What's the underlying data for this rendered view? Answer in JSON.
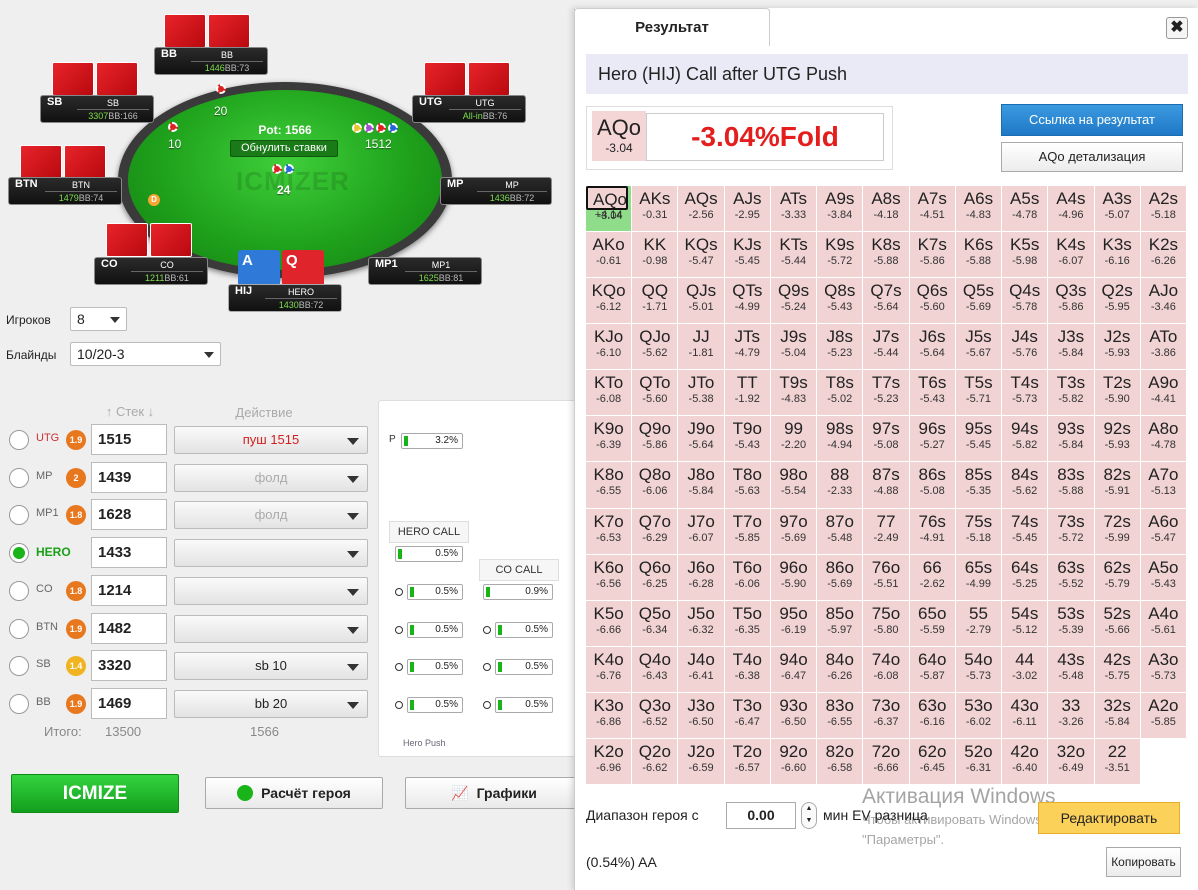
{
  "table": {
    "pot": "Pot: 1566",
    "reset_label": "Обнулить ставки",
    "watermark": "ICMIZER",
    "dealer": "D",
    "bets": {
      "bb": "20",
      "sb": "10",
      "utg": "1512",
      "hero": "24"
    },
    "seats": [
      {
        "id": "bb",
        "pos": "BB",
        "name": "BB",
        "stack": "1446",
        "bb": "BB:73"
      },
      {
        "id": "sb",
        "pos": "SB",
        "name": "SB",
        "stack": "3307",
        "bb": "BB:166"
      },
      {
        "id": "utg",
        "pos": "UTG",
        "name": "UTG",
        "stack": "All-in",
        "bb": "BB:76"
      },
      {
        "id": "btn",
        "pos": "BTN",
        "name": "BTN",
        "stack": "1479",
        "bb": "BB:74"
      },
      {
        "id": "mp",
        "pos": "MP",
        "name": "MP",
        "stack": "1436",
        "bb": "BB:72"
      },
      {
        "id": "co",
        "pos": "CO",
        "name": "CO",
        "stack": "1211",
        "bb": "BB:61"
      },
      {
        "id": "mp1",
        "pos": "MP1",
        "name": "MP1",
        "stack": "1625",
        "bb": "BB:81"
      },
      {
        "id": "hero",
        "pos": "HIJ",
        "name": "HERO",
        "stack": "1430",
        "bb": "BB:72"
      }
    ],
    "hero_cards": [
      "A",
      "Q"
    ]
  },
  "settings": {
    "players_label": "Игроков",
    "players_value": "8",
    "blinds_label": "Блайнды",
    "blinds_value": "10/20-3"
  },
  "columns": {
    "stack": "Стек",
    "action": "Действие"
  },
  "players": [
    {
      "pos": "UTG",
      "badge": "1.9",
      "stack": "1515",
      "action": "пуш 1515"
    },
    {
      "pos": "MP",
      "badge": "2",
      "stack": "1439",
      "action": "фолд"
    },
    {
      "pos": "MP1",
      "badge": "1.8",
      "stack": "1628",
      "action": "фолд"
    },
    {
      "pos": "HERO",
      "badge": "",
      "stack": "1433",
      "action": ""
    },
    {
      "pos": "CO",
      "badge": "1.8",
      "stack": "1214",
      "action": ""
    },
    {
      "pos": "BTN",
      "badge": "1.9",
      "stack": "1482",
      "action": ""
    },
    {
      "pos": "SB",
      "badge": "1.4",
      "stack": "3320",
      "action": "sb 10"
    },
    {
      "pos": "BB",
      "badge": "1.9",
      "stack": "1469",
      "action": "bb 20"
    }
  ],
  "totals": {
    "label": "Итого:",
    "stack": "13500",
    "pot": "1566"
  },
  "buttons": {
    "icmize": "ICMIZE",
    "hero_calc": "Расчёт героя",
    "charts": "Графики"
  },
  "tree": {
    "p_label": "P",
    "p_value": "3.2%",
    "hero_call": "HERO CALL",
    "co_call": "CO CALL",
    "hero_vals": [
      "0.5%",
      "0.5%",
      "0.5%",
      "0.5%",
      "0.5%"
    ],
    "co_vals": [
      "0.9%",
      "0.5%",
      "0.5%",
      "0.5%"
    ],
    "footer": "Hero Push"
  },
  "result": {
    "tab": "Результат",
    "close": "✖",
    "title": "Hero (HIJ) Call after UTG Push",
    "hand": "AQo",
    "hand_ev": "-3.04",
    "verdict": "-3.04%Fold",
    "link_btn": "Ссылка на результат",
    "detail_btn": "AQo детализация",
    "range_label": "Диапазон героя с",
    "ev_value": "0.00",
    "ev_label": "мин EV разница",
    "edit_btn": "Редактировать",
    "result_text": "(0.54%) AA",
    "copy_btn": "Копировать",
    "watermark_title": "Активация Windows",
    "watermark_line1": "Чтобы активировать Windows, перейдите в",
    "watermark_line2": "\"Параметры\"."
  },
  "grid": [
    [
      [
        "AA",
        "+4.14"
      ],
      [
        "AKs",
        "-0.31"
      ],
      [
        "AQs",
        "-2.56"
      ],
      [
        "AJs",
        "-2.95"
      ],
      [
        "ATs",
        "-3.33"
      ],
      [
        "A9s",
        "-3.84"
      ],
      [
        "A8s",
        "-4.18"
      ],
      [
        "A7s",
        "-4.51"
      ],
      [
        "A6s",
        "-4.83"
      ],
      [
        "A5s",
        "-4.78"
      ],
      [
        "A4s",
        "-4.96"
      ],
      [
        "A3s",
        "-5.07"
      ],
      [
        "A2s",
        "-5.18"
      ]
    ],
    [
      [
        "AKo",
        "-0.61"
      ],
      [
        "KK",
        "-0.98"
      ],
      [
        "KQs",
        "-5.47"
      ],
      [
        "KJs",
        "-5.45"
      ],
      [
        "KTs",
        "-5.44"
      ],
      [
        "K9s",
        "-5.72"
      ],
      [
        "K8s",
        "-5.88"
      ],
      [
        "K7s",
        "-5.86"
      ],
      [
        "K6s",
        "-5.88"
      ],
      [
        "K5s",
        "-5.98"
      ],
      [
        "K4s",
        "-6.07"
      ],
      [
        "K3s",
        "-6.16"
      ],
      [
        "K2s",
        "-6.26"
      ]
    ],
    [
      [
        "AQo",
        "-3.04"
      ],
      [
        "KQo",
        "-6.12"
      ],
      [
        "QQ",
        "-1.71"
      ],
      [
        "QJs",
        "-5.01"
      ],
      [
        "QTs",
        "-4.99"
      ],
      [
        "Q9s",
        "-5.24"
      ],
      [
        "Q8s",
        "-5.43"
      ],
      [
        "Q7s",
        "-5.64"
      ],
      [
        "Q6s",
        "-5.60"
      ],
      [
        "Q5s",
        "-5.69"
      ],
      [
        "Q4s",
        "-5.78"
      ],
      [
        "Q3s",
        "-5.86"
      ],
      [
        "Q2s",
        "-5.95"
      ]
    ],
    [
      [
        "AJo",
        "-3.46"
      ],
      [
        "KJo",
        "-6.10"
      ],
      [
        "QJo",
        "-5.62"
      ],
      [
        "JJ",
        "-1.81"
      ],
      [
        "JTs",
        "-4.79"
      ],
      [
        "J9s",
        "-5.04"
      ],
      [
        "J8s",
        "-5.23"
      ],
      [
        "J7s",
        "-5.44"
      ],
      [
        "J6s",
        "-5.64"
      ],
      [
        "J5s",
        "-5.67"
      ],
      [
        "J4s",
        "-5.76"
      ],
      [
        "J3s",
        "-5.84"
      ],
      [
        "J2s",
        "-5.93"
      ]
    ],
    [
      [
        "ATo",
        "-3.86"
      ],
      [
        "KTo",
        "-6.08"
      ],
      [
        "QTo",
        "-5.60"
      ],
      [
        "JTo",
        "-5.38"
      ],
      [
        "TT",
        "-1.92"
      ],
      [
        "T9s",
        "-4.83"
      ],
      [
        "T8s",
        "-5.02"
      ],
      [
        "T7s",
        "-5.23"
      ],
      [
        "T6s",
        "-5.43"
      ],
      [
        "T5s",
        "-5.71"
      ],
      [
        "T4s",
        "-5.73"
      ],
      [
        "T3s",
        "-5.82"
      ],
      [
        "T2s",
        "-5.90"
      ]
    ],
    [
      [
        "A9o",
        "-4.41"
      ],
      [
        "K9o",
        "-6.39"
      ],
      [
        "Q9o",
        "-5.86"
      ],
      [
        "J9o",
        "-5.64"
      ],
      [
        "T9o",
        "-5.43"
      ],
      [
        "99",
        "-2.20"
      ],
      [
        "98s",
        "-4.94"
      ],
      [
        "97s",
        "-5.08"
      ],
      [
        "96s",
        "-5.27"
      ],
      [
        "95s",
        "-5.45"
      ],
      [
        "94s",
        "-5.82"
      ],
      [
        "93s",
        "-5.84"
      ],
      [
        "92s",
        "-5.93"
      ]
    ],
    [
      [
        "A8o",
        "-4.78"
      ],
      [
        "K8o",
        "-6.55"
      ],
      [
        "Q8o",
        "-6.06"
      ],
      [
        "J8o",
        "-5.84"
      ],
      [
        "T8o",
        "-5.63"
      ],
      [
        "98o",
        "-5.54"
      ],
      [
        "88",
        "-2.33"
      ],
      [
        "87s",
        "-4.88"
      ],
      [
        "86s",
        "-5.08"
      ],
      [
        "85s",
        "-5.35"
      ],
      [
        "84s",
        "-5.62"
      ],
      [
        "83s",
        "-5.88"
      ],
      [
        "82s",
        "-5.91"
      ]
    ],
    [
      [
        "A7o",
        "-5.13"
      ],
      [
        "K7o",
        "-6.53"
      ],
      [
        "Q7o",
        "-6.29"
      ],
      [
        "J7o",
        "-6.07"
      ],
      [
        "T7o",
        "-5.85"
      ],
      [
        "97o",
        "-5.69"
      ],
      [
        "87o",
        "-5.48"
      ],
      [
        "77",
        "-2.49"
      ],
      [
        "76s",
        "-4.91"
      ],
      [
        "75s",
        "-5.18"
      ],
      [
        "74s",
        "-5.45"
      ],
      [
        "73s",
        "-5.72"
      ],
      [
        "72s",
        "-5.99"
      ]
    ],
    [
      [
        "A6o",
        "-5.47"
      ],
      [
        "K6o",
        "-6.56"
      ],
      [
        "Q6o",
        "-6.25"
      ],
      [
        "J6o",
        "-6.28"
      ],
      [
        "T6o",
        "-6.06"
      ],
      [
        "96o",
        "-5.90"
      ],
      [
        "86o",
        "-5.69"
      ],
      [
        "76o",
        "-5.51"
      ],
      [
        "66",
        "-2.62"
      ],
      [
        "65s",
        "-4.99"
      ],
      [
        "64s",
        "-5.25"
      ],
      [
        "63s",
        "-5.52"
      ],
      [
        "62s",
        "-5.79"
      ]
    ],
    [
      [
        "A5o",
        "-5.43"
      ],
      [
        "K5o",
        "-6.66"
      ],
      [
        "Q5o",
        "-6.34"
      ],
      [
        "J5o",
        "-6.32"
      ],
      [
        "T5o",
        "-6.35"
      ],
      [
        "95o",
        "-6.19"
      ],
      [
        "85o",
        "-5.97"
      ],
      [
        "75o",
        "-5.80"
      ],
      [
        "65o",
        "-5.59"
      ],
      [
        "55",
        "-2.79"
      ],
      [
        "54s",
        "-5.12"
      ],
      [
        "53s",
        "-5.39"
      ],
      [
        "52s",
        "-5.66"
      ]
    ],
    [
      [
        "A4o",
        "-5.61"
      ],
      [
        "K4o",
        "-6.76"
      ],
      [
        "Q4o",
        "-6.43"
      ],
      [
        "J4o",
        "-6.41"
      ],
      [
        "T4o",
        "-6.38"
      ],
      [
        "94o",
        "-6.47"
      ],
      [
        "84o",
        "-6.26"
      ],
      [
        "74o",
        "-6.08"
      ],
      [
        "64o",
        "-5.87"
      ],
      [
        "54o",
        "-5.73"
      ],
      [
        "44",
        "-3.02"
      ],
      [
        "43s",
        "-5.48"
      ],
      [
        "42s",
        "-5.75"
      ]
    ],
    [
      [
        "A3o",
        "-5.73"
      ],
      [
        "K3o",
        "-6.86"
      ],
      [
        "Q3o",
        "-6.52"
      ],
      [
        "J3o",
        "-6.50"
      ],
      [
        "T3o",
        "-6.47"
      ],
      [
        "93o",
        "-6.50"
      ],
      [
        "83o",
        "-6.55"
      ],
      [
        "73o",
        "-6.37"
      ],
      [
        "63o",
        "-6.16"
      ],
      [
        "53o",
        "-6.02"
      ],
      [
        "43o",
        "-6.11"
      ],
      [
        "33",
        "-3.26"
      ],
      [
        "32s",
        "-5.84"
      ]
    ],
    [
      [
        "A2o",
        "-5.85"
      ],
      [
        "K2o",
        "-6.96"
      ],
      [
        "Q2o",
        "-6.62"
      ],
      [
        "J2o",
        "-6.59"
      ],
      [
        "T2o",
        "-6.57"
      ],
      [
        "92o",
        "-6.60"
      ],
      [
        "82o",
        "-6.58"
      ],
      [
        "72o",
        "-6.66"
      ],
      [
        "62o",
        "-6.45"
      ],
      [
        "52o",
        "-6.31"
      ],
      [
        "42o",
        "-6.40"
      ],
      [
        "32o",
        "-6.49"
      ],
      [
        "22",
        "-3.51"
      ]
    ]
  ],
  "colors": {
    "green": "#18b418",
    "red": "#e41d1d",
    "cell": "#f1d3d3",
    "positive": "#8fdc8a"
  }
}
